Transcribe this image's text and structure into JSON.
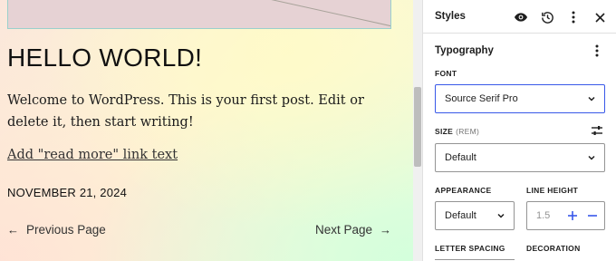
{
  "canvas": {
    "post_title": "HELLO WORLD!",
    "excerpt": "Welcome to WordPress. This is your first post. Edit or delete it, then start writing!",
    "read_more": "Add \"read more\" link text",
    "date": "NOVEMBER 21, 2024",
    "prev_page": "Previous Page",
    "next_page": "Next Page"
  },
  "sidebar": {
    "title": "Styles",
    "header_icons": [
      "eye-icon",
      "history-icon",
      "more-vertical-icon",
      "close-icon"
    ],
    "typography": {
      "title": "Typography",
      "font_label": "FONT",
      "font_value": "Source Serif Pro",
      "size_label": "SIZE",
      "size_unit": "(REM)",
      "size_value": "Default",
      "appearance_label": "APPEARANCE",
      "appearance_value": "Default",
      "line_height_label": "LINE HEIGHT",
      "line_height_value": "1.5",
      "letter_spacing_label": "LETTER SPACING",
      "decoration_label": "DECORATION"
    }
  },
  "colors": {
    "accent": "#3858e9",
    "border": "#949494",
    "text": "#1e1e1e"
  }
}
